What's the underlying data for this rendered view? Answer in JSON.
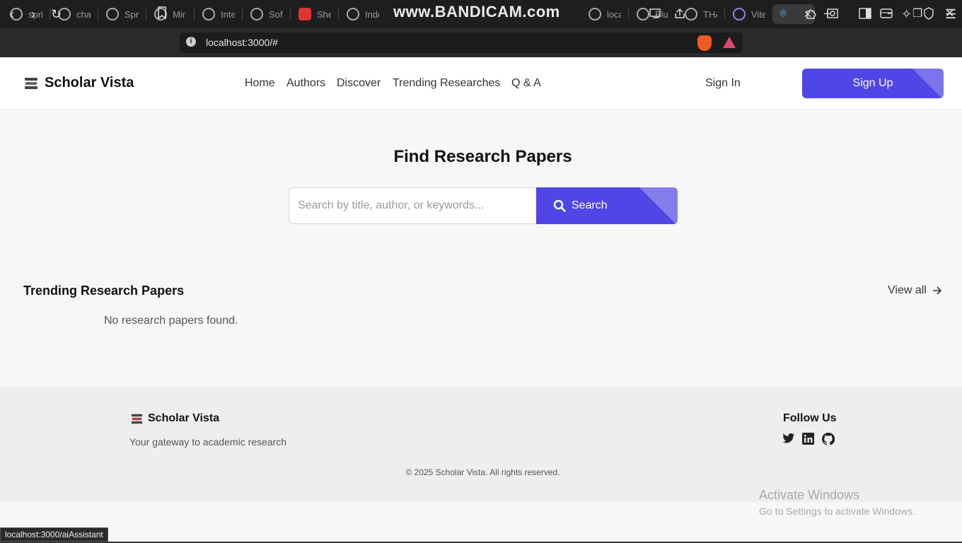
{
  "browser": {
    "watermark": "www.BANDICAM.com",
    "tabs": [
      {
        "title": "spri"
      },
      {
        "title": "cha"
      },
      {
        "title": "Spr"
      },
      {
        "title": "Mir"
      },
      {
        "title": "Inte"
      },
      {
        "title": "Soft"
      },
      {
        "title": "She"
      },
      {
        "title": "Inde"
      },
      {
        "title": "loca"
      },
      {
        "title": "Blu"
      },
      {
        "title": "THA"
      },
      {
        "title": "Vite"
      }
    ],
    "address": "localhost:3000/#",
    "status_url": "localhost:3000/aiAssistant"
  },
  "header": {
    "brand": "Scholar Vista",
    "nav": [
      "Home",
      "Authors",
      "Discover",
      "Trending Researches",
      "Q & A"
    ],
    "sign_in": "Sign In",
    "sign_up": "Sign Up"
  },
  "hero": {
    "title": "Find Research Papers",
    "search_placeholder": "Search by title, author, or keywords...",
    "search_button": "Search"
  },
  "trending": {
    "title": "Trending Research Papers",
    "view_all": "View all",
    "empty": "No research papers found."
  },
  "footer": {
    "brand": "Scholar Vista",
    "tagline": "Your gateway to academic research",
    "follow_title": "Follow Us",
    "social": [
      "twitter-icon",
      "linkedin-icon",
      "github-icon"
    ],
    "copyright": "© 2025 Scholar Vista. All rights reserved."
  },
  "os": {
    "activate_title": "Activate Windows",
    "activate_sub": "Go to Settings to activate Windows."
  },
  "colors": {
    "accent": "#4f46e5",
    "page_bg": "#f7f7f7",
    "footer_bg": "#eeeeee"
  }
}
